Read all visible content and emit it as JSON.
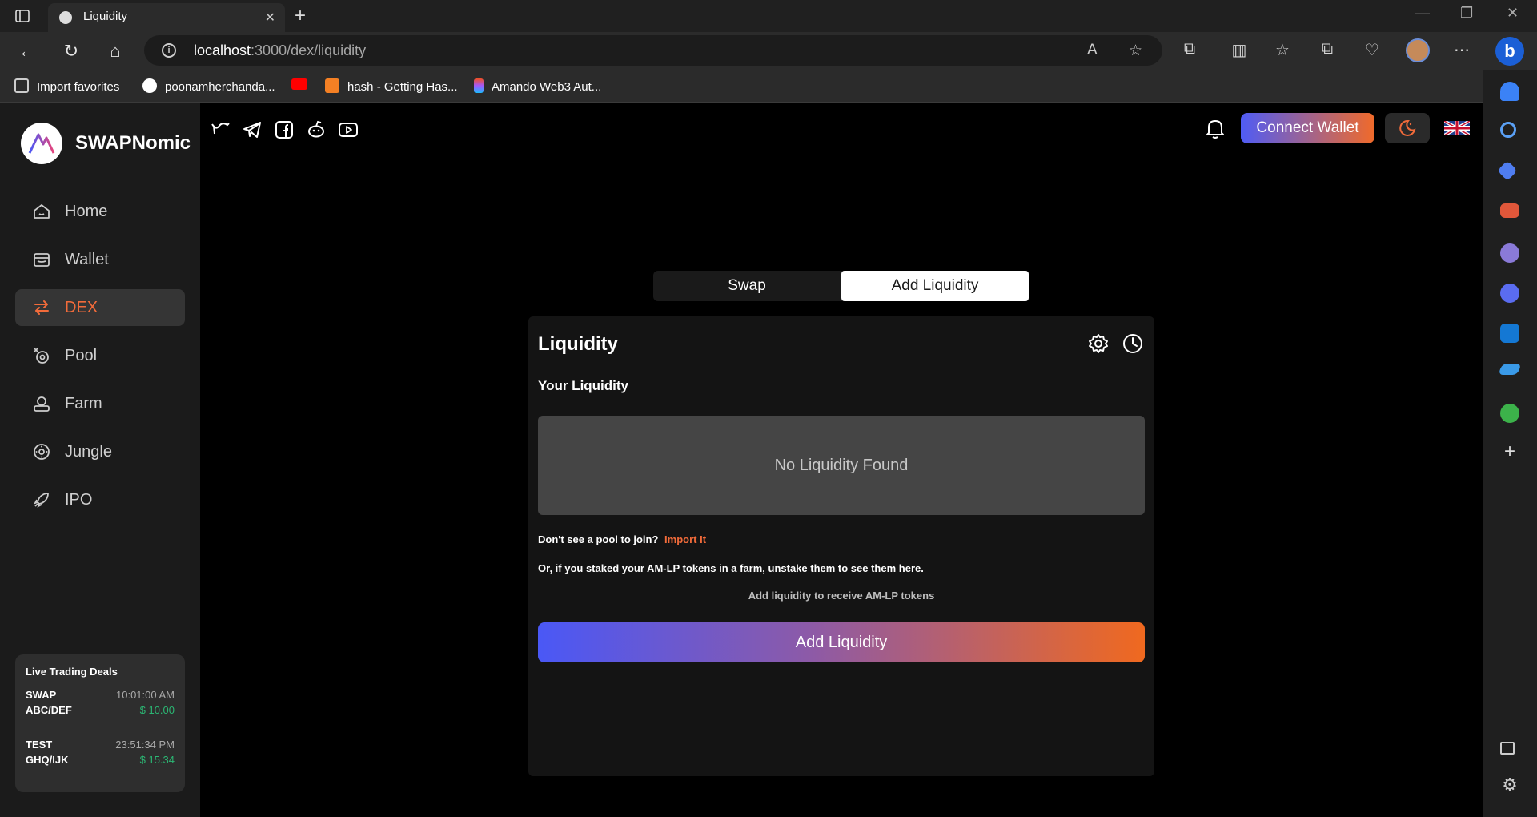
{
  "browser": {
    "tab_title": "Liquidity",
    "url_host": "localhost",
    "url_path": ":3000/dex/liquidity",
    "favorites": [
      {
        "label": "Import favorites"
      },
      {
        "label": "poonamherchanda..."
      },
      {
        "label": ""
      },
      {
        "label": "hash - Getting Has..."
      },
      {
        "label": "Amando Web3 Aut..."
      }
    ]
  },
  "app": {
    "brand": "SWAPNomic",
    "connect_wallet": "Connect Wallet",
    "nav": [
      {
        "label": "Home",
        "icon": "home-icon"
      },
      {
        "label": "Wallet",
        "icon": "wallet-icon"
      },
      {
        "label": "DEX",
        "icon": "swap-arrows-icon",
        "active": true
      },
      {
        "label": "Pool",
        "icon": "pool-icon"
      },
      {
        "label": "Farm",
        "icon": "farm-icon"
      },
      {
        "label": "Jungle",
        "icon": "jungle-icon"
      },
      {
        "label": "IPO",
        "icon": "rocket-icon"
      }
    ],
    "deals": {
      "title": "Live Trading Deals",
      "items": [
        {
          "name": "SWAP",
          "pair": "ABC/DEF",
          "time": "10:01:00 AM",
          "price": "$ 10.00"
        },
        {
          "name": "TEST",
          "pair": "GHQ/IJK",
          "time": "23:51:34 PM",
          "price": "$ 15.34"
        }
      ]
    },
    "tabs": {
      "swap": "Swap",
      "add_liquidity": "Add Liquidity"
    },
    "card": {
      "title": "Liquidity",
      "your_liquidity": "Your Liquidity",
      "empty": "No Liquidity Found",
      "join_q": "Don't see a pool to join?",
      "import_link": "Import It",
      "staked_note": "Or, if you staked your AM-LP tokens in a farm, unstake them to see them here.",
      "receive_note": "Add liquidity to receive AM-LP tokens",
      "add_button": "Add Liquidity"
    },
    "colors": {
      "accent": "#f26b3a",
      "gradient_start": "#4a58f6",
      "gradient_end": "#f0691f",
      "price_green": "#2bb673"
    }
  }
}
